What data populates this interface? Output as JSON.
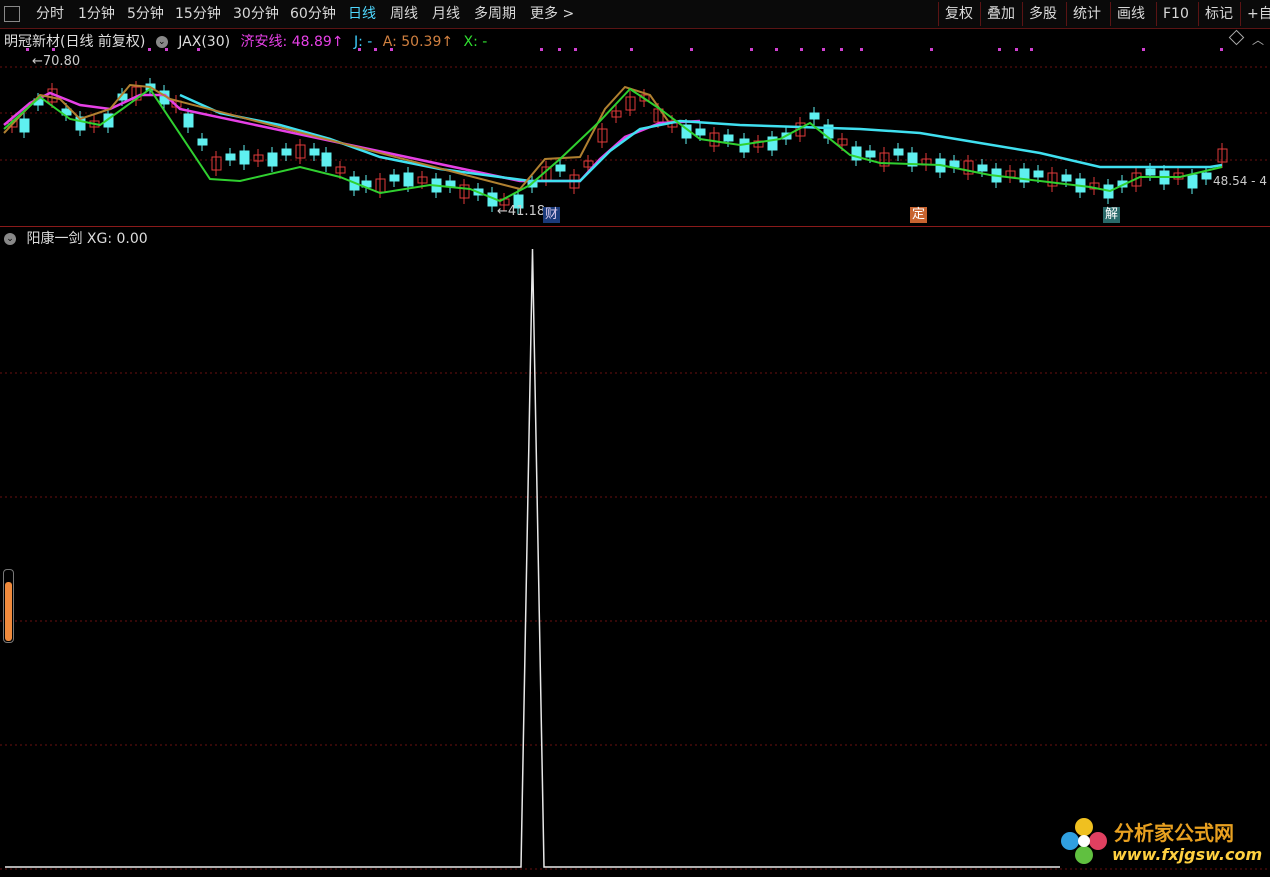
{
  "toolbar": {
    "items": [
      "分时",
      "1分钟",
      "5分钟",
      "15分钟",
      "30分钟",
      "60分钟",
      "日线",
      "周线",
      "月线",
      "多周期",
      "更多 >"
    ],
    "active_index": 6,
    "right_items": [
      "复权",
      "叠加",
      "多股",
      "统计",
      "画线",
      "F10",
      "标记",
      "+自"
    ]
  },
  "top_pane": {
    "stock": "明冠新材(日线 前复权)",
    "indicator": "JAX(30)",
    "jian_label": "济安线: 48.89↑",
    "j_label": "J: -",
    "a_label": "A: 50.39↑",
    "x_label": "X: -",
    "high_label": "←70.80",
    "low_label": "←41.18",
    "last_label": "48.54 - 4",
    "badges": [
      "财",
      "定",
      "解"
    ]
  },
  "bottom_pane": {
    "indicator": "阳康一剑 XG: 0.00"
  },
  "watermark": {
    "title": "分析家公式网",
    "url": "www.fxjgsw.com"
  },
  "colors": {
    "up": "#e03a3a",
    "down": "#5ff0f0",
    "jian": "#e640e6",
    "j": "#3fd0ff",
    "a": "#d08040",
    "x": "#30e030",
    "grid": "#6a1010"
  },
  "chart_data": {
    "type": "line",
    "series": [
      {
        "values": [
          0,
          0,
          0,
          0,
          0,
          0,
          0,
          0,
          0,
          0,
          0,
          0,
          0,
          0,
          0,
          0,
          0,
          0,
          0,
          0,
          0,
          0,
          0,
          0,
          0,
          0,
          0,
          0,
          0,
          0,
          0,
          0,
          0,
          0,
          0,
          0,
          0,
          0,
          0,
          0,
          0,
          0,
          0,
          0,
          0,
          0,
          1,
          0,
          0,
          0,
          0,
          0,
          0,
          0,
          0,
          0,
          0,
          0,
          0,
          0,
          0,
          0,
          0,
          0,
          0,
          0,
          0,
          0,
          0,
          0,
          0,
          0,
          0,
          0,
          0,
          0,
          0,
          0,
          0,
          0,
          0,
          0,
          0,
          0,
          0,
          0,
          0,
          0,
          0,
          0,
          0,
          0,
          0
        ]
      }
    ],
    "ylim": [
      0,
      1
    ]
  }
}
